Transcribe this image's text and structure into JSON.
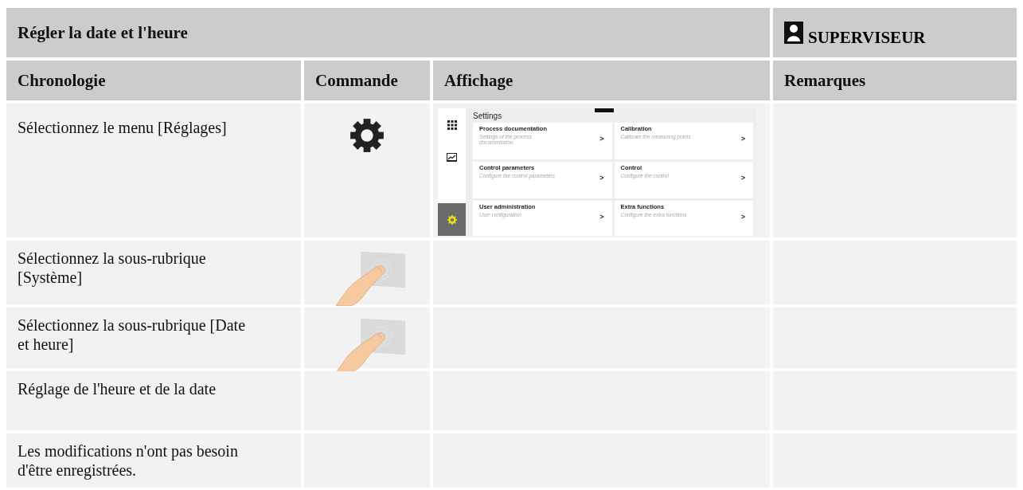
{
  "header": {
    "title": "Régler la date et l'heure",
    "role": "SUPERVISEUR"
  },
  "columns": [
    "Chronologie",
    "Commande",
    "Affichage",
    "Remarques"
  ],
  "rows": [
    {
      "step": "Sélectionnez le menu [Réglages]",
      "command": {
        "kind": "gear"
      },
      "display": {
        "kind": "settings",
        "title": "Settings",
        "nav": [
          {
            "selected": false
          },
          {
            "selected": false
          },
          {
            "selected": true
          }
        ],
        "tiles": [
          {
            "title": "Process documentation",
            "subtitle": "Settings of the process documentation",
            "arrow": ">"
          },
          {
            "title": "Calibration",
            "subtitle": "Calibrate the measuring points",
            "arrow": ">"
          },
          {
            "title": "Control parameters",
            "subtitle": "Configure the control parameters",
            "arrow": ">"
          },
          {
            "title": "Control",
            "subtitle": "Configure the control",
            "arrow": ">"
          },
          {
            "title": "User administration",
            "subtitle": "User configuration",
            "arrow": ">"
          },
          {
            "title": "Extra functions",
            "subtitle": "Configure the extra functions",
            "arrow": ">"
          }
        ]
      }
    },
    {
      "step": "Sélectionnez la sous-rubrique [Système]",
      "command": {
        "kind": "touch"
      }
    },
    {
      "step": "Sélectionnez la sous-rubrique [Date et heure]",
      "command": {
        "kind": "touch"
      }
    },
    {
      "step": "Réglage de l'heure et de la date"
    },
    {
      "step": "Les modifications n'ont pas besoin d'être enregistrées."
    }
  ]
}
